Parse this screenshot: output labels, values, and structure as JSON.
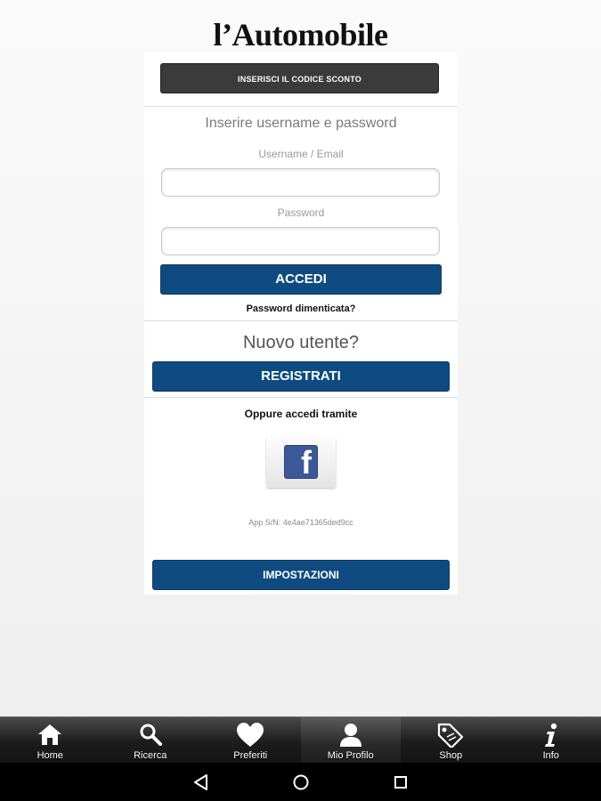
{
  "header": {
    "brand": "l’Automobile"
  },
  "coupon": {
    "label": "INSERISCI IL CODICE SCONTO"
  },
  "login": {
    "title": "Inserire username e password",
    "username_label": "Username / Email",
    "username_value": "",
    "password_label": "Password",
    "password_value": "",
    "submit_label": "ACCEDI",
    "forgot_label": "Password dimenticata?"
  },
  "register": {
    "title": "Nuovo utente?",
    "button_label": "REGISTRATI"
  },
  "social": {
    "title": "Oppure accedi tramite",
    "facebook_icon": "facebook-icon",
    "facebook_letter": "f"
  },
  "app": {
    "serial": "App S/N: 4e4ae71365ded9cc"
  },
  "settings": {
    "button_label": "IMPOSTAZIONI"
  },
  "tabbar": {
    "items": [
      {
        "label": "Home",
        "icon": "home-icon"
      },
      {
        "label": "Ricerca",
        "icon": "search-icon"
      },
      {
        "label": "Preferiti",
        "icon": "heart-icon"
      },
      {
        "label": "Mio Profilo",
        "icon": "user-icon",
        "active": true
      },
      {
        "label": "Shop",
        "icon": "tag-icon"
      },
      {
        "label": "Info",
        "icon": "info-icon"
      }
    ]
  },
  "colors": {
    "primary": "#0f4b81",
    "dark_button": "#3b3b3b",
    "facebook": "#3b5998"
  }
}
